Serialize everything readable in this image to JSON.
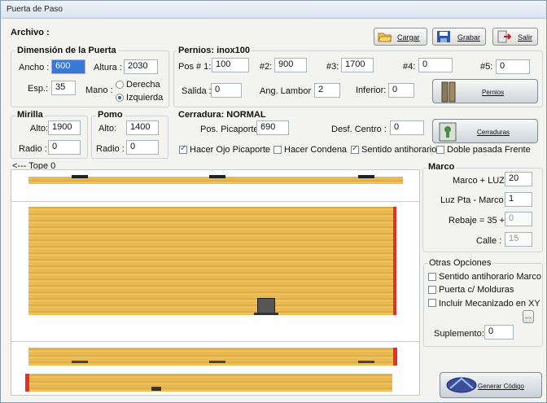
{
  "window": {
    "title": "Puerta de Paso"
  },
  "header": {
    "archivo": "Archivo :"
  },
  "toolbar": {
    "cargar": "Cargar",
    "grabar": "Grabar",
    "salir": "Salir"
  },
  "dimension": {
    "title": "Dimensión de la Puerta",
    "ancho_label": "Ancho :",
    "ancho": "600",
    "altura_label": "Altura :",
    "altura": "2030",
    "esp_label": "Esp.:",
    "esp": "35",
    "mano_label": "Mano :",
    "derecha": "Derecha",
    "izquierda": "Izquierda"
  },
  "pernios": {
    "title": "Pernios: inox100",
    "pos1_label": "Pos # 1:",
    "pos1": "100",
    "pos2_label": "#2:",
    "pos2": "900",
    "pos3_label": "#3:",
    "pos3": "1700",
    "pos4_label": "#4:",
    "pos4": "0",
    "pos5_label": "#5:",
    "pos5": "0",
    "salida_label": "Salida :",
    "salida": "0",
    "ang_label": "Ang. Lambor :",
    "ang": "2",
    "inferior_label": "Inferior:",
    "inferior": "0",
    "button": "Pernios"
  },
  "mirilla": {
    "title": "Mirilla",
    "alto_label": "Alto:",
    "alto": "1900",
    "radio_label": "Radio :",
    "radio": "0"
  },
  "pomo": {
    "title": "Pomo",
    "alto_label": "Alto:",
    "alto": "1400",
    "radio_label": "Radio :",
    "radio": "0"
  },
  "cerradura": {
    "title": "Cerradura: NORMAL",
    "pos_label": "Pos. Picaporte",
    "pos": "690",
    "desf_label": "Desf. Centro :",
    "desf": "0",
    "button": "Cerraduras",
    "hacer_ojo": "Hacer Ojo Picaporte",
    "hacer_condena": "Hacer Condena",
    "sentido": "Sentido antihorario",
    "doble": "Doble pasada Frente"
  },
  "tope": "<--- Tope 0",
  "marco": {
    "title": "Marco",
    "marco_luz_label": "Marco + LUZ:",
    "marco_luz": "20",
    "luz_label": "Luz Pta - Marco :",
    "luz": "1",
    "rebaje_label": "Rebaje =  35 +",
    "rebaje": "0",
    "calle_label": "Calle :",
    "calle": "15"
  },
  "otras": {
    "title": "Otras Opciones",
    "sentido_marco": "Sentido antihorario Marco",
    "molduras": "Puerta c/ Molduras",
    "mecanizado": "Incluir Mecanizado en XY",
    "browse": "...",
    "suplemento_label": "Suplemento:",
    "suplemento": "0"
  },
  "generar": "Generar Código",
  "colors": {
    "selection": "#3b77d6",
    "edge": "#e53030",
    "wood": "#e8b84c"
  }
}
